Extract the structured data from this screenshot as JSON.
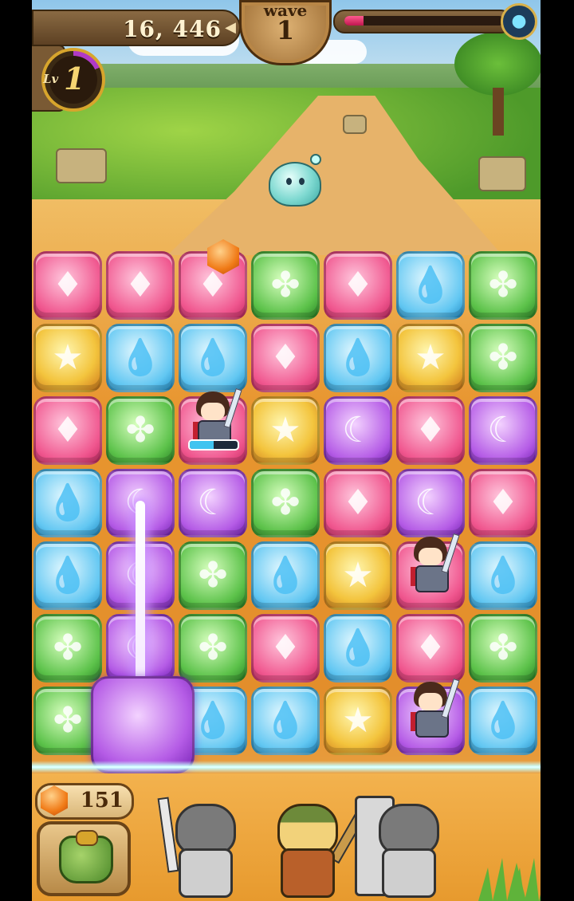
{
  "hud": {
    "score": "16, 446",
    "score_icon": "arrow-left-icon",
    "wave_label": "wave",
    "wave_number": "1",
    "enemy_hp_fraction": 0.12,
    "enemy_icon": "cat-demon-icon",
    "level_label": "Lv",
    "level_number": "1",
    "level_progress_fraction": 0.18
  },
  "board": {
    "rows": 7,
    "cols": 7,
    "tiles": [
      [
        "heart",
        "heart",
        "heart",
        "leaf",
        "heart",
        "water",
        "leaf"
      ],
      [
        "star",
        "water",
        "water",
        "heart",
        "water",
        "star",
        "leaf"
      ],
      [
        "heart",
        "leaf",
        "heart",
        "star",
        "moon",
        "heart",
        "moon"
      ],
      [
        "water",
        "moon",
        "moon",
        "leaf",
        "heart",
        "moon",
        "heart"
      ],
      [
        "water",
        "moon",
        "leaf",
        "water",
        "star",
        "heart",
        "water"
      ],
      [
        "leaf",
        "moon",
        "leaf",
        "heart",
        "water",
        "heart",
        "leaf"
      ],
      [
        "leaf",
        "moon",
        "water",
        "water",
        "star",
        "moon",
        "water"
      ]
    ],
    "hero_tiles": [
      {
        "row": 2,
        "col": 2,
        "charge_fraction": 0.5
      },
      {
        "row": 4,
        "col": 5
      },
      {
        "row": 6,
        "col": 5
      }
    ],
    "dropped_item": {
      "type": "gem",
      "row": 0,
      "col": 2
    },
    "dragging": {
      "tile": "moon",
      "from_row": 6,
      "from_col": 1,
      "trail_rows": [
        3,
        4,
        5,
        6
      ],
      "trail_col": 1
    }
  },
  "tile_symbols": {
    "heart": "♦",
    "water": "💧",
    "leaf": "✤",
    "star": "★",
    "moon": "☾"
  },
  "tile_colors": {
    "heart": "#f0578f",
    "water": "#62c7f2",
    "leaf": "#5cc24a",
    "star": "#f3c43d",
    "moon": "#b55ce6"
  },
  "bottom": {
    "gem_count": "151",
    "gem_icon": "orange-gem-icon",
    "bag_icon": "green-backpack-icon",
    "party": [
      {
        "name": "swordsman",
        "active": false
      },
      {
        "name": "archer",
        "active": true
      },
      {
        "name": "knight",
        "active": false
      }
    ]
  },
  "enemy": {
    "type": "blue-slime"
  }
}
